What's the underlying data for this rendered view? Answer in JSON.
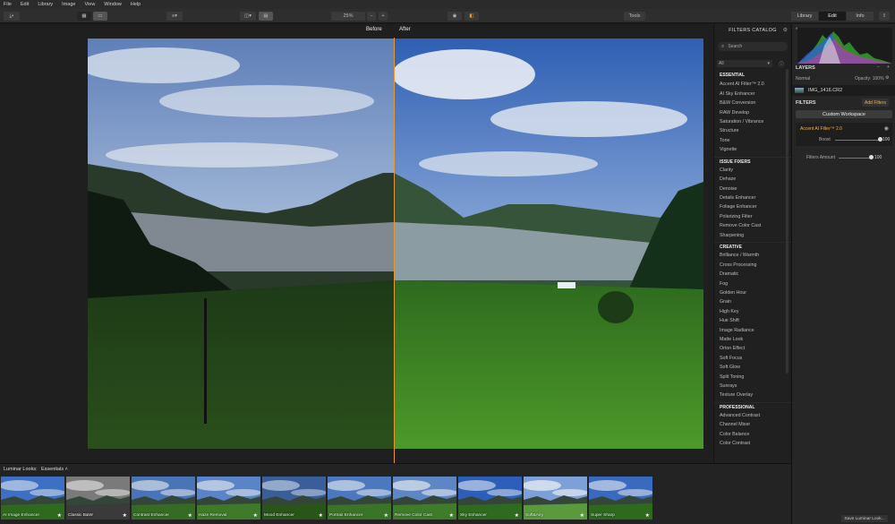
{
  "menu": [
    "File",
    "Edit",
    "Library",
    "Image",
    "View",
    "Window",
    "Help"
  ],
  "toolbar": {
    "zoom": "25%",
    "zoom_minus": "−",
    "zoom_plus": "+",
    "tools": "Tools",
    "tabs": [
      "Library",
      "Edit",
      "Info"
    ]
  },
  "canvas": {
    "before_label": "Before",
    "after_label": "After"
  },
  "catalog": {
    "title": "FILTERS CATALOG",
    "search_placeholder": "Search",
    "filter_select": "All",
    "sections": [
      {
        "name": "ESSENTIAL",
        "items": [
          "Accent AI Filter™ 2.0",
          "AI Sky Enhancer",
          "B&W Conversion",
          "RAW Develop",
          "Saturation / Vibrance",
          "Structure",
          "Tone",
          "Vignette"
        ]
      },
      {
        "name": "ISSUE FIXERS",
        "items": [
          "Clarity",
          "Dehaze",
          "Denoise",
          "Details Enhancer",
          "Foliage Enhancer",
          "Polarizing Filter",
          "Remove Color Cast",
          "Sharpening"
        ]
      },
      {
        "name": "CREATIVE",
        "items": [
          "Brilliance / Warmth",
          "Cross Processing",
          "Dramatic",
          "Fog",
          "Golden Hour",
          "Grain",
          "High Key",
          "Hue Shift",
          "Image Radiance",
          "Matte Look",
          "Orton Effect",
          "Soft Focus",
          "Soft Glow",
          "Split Toning",
          "Sunrays",
          "Texture Overlay"
        ]
      },
      {
        "name": "PROFESSIONAL",
        "items": [
          "Advanced Contrast",
          "Channel Mixer",
          "Color Balance",
          "Color Contrast"
        ]
      }
    ]
  },
  "panel": {
    "layers_title": "LAYERS",
    "blend_mode": "Normal",
    "opacity": "Opacity: 100%",
    "layer_name": "IMG_1416.CR2",
    "filters_title": "FILTERS",
    "add_filters": "Add Filters",
    "custom_workspace": "Custom Workspace",
    "accent_filter": "Accent AI Filter™ 2.0",
    "boost_label": "Boost",
    "boost_value": "100",
    "boost_level": 1.0,
    "filters_amount_label": "Filters Amount",
    "filters_amount_value": "100",
    "filters_amount_level": 1.0
  },
  "looks": {
    "title": "Luminar Looks:",
    "category": "Essentials",
    "items": [
      "AI Image Enhancer",
      "Classic B&W",
      "Contrast Enhancer",
      "Haze Removal",
      "Mood Enhancer",
      "Portrait Enhancer",
      "Remove Color Cast",
      "Sky Enhancer",
      "Soft&Airy",
      "Super Sharp"
    ],
    "save_label": "Save Luminar Look..."
  },
  "colors": {
    "accent": "#e19a36",
    "panel_bg": "#262626"
  }
}
